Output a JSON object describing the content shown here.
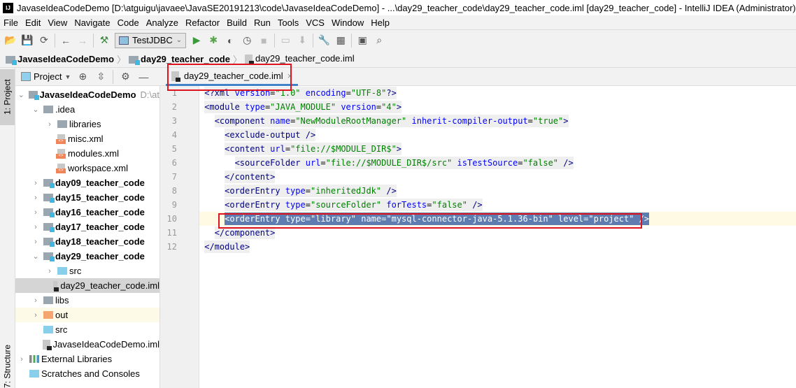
{
  "window": {
    "title": "JavaseIdeaCodeDemo [D:\\atguigu\\javaee\\JavaSE20191213\\code\\JavaseIdeaCodeDemo] - ...\\day29_teacher_code\\day29_teacher_code.iml [day29_teacher_code] - IntelliJ IDEA (Administrator)",
    "logo": "IJ"
  },
  "menu": [
    "File",
    "Edit",
    "View",
    "Navigate",
    "Code",
    "Analyze",
    "Refactor",
    "Build",
    "Run",
    "Tools",
    "VCS",
    "Window",
    "Help"
  ],
  "toolbar": {
    "run_config": "TestJDBC"
  },
  "breadcrumb": [
    "JavaseIdeaCodeDemo",
    "day29_teacher_code",
    "day29_teacher_code.iml"
  ],
  "stripe": {
    "project": "1: Project",
    "structure": "7: Structure"
  },
  "project_panel": {
    "title": "Project"
  },
  "tree": [
    {
      "label": "JavaseIdeaCodeDemo",
      "suffix": "D:\\at",
      "depth": 0,
      "arrow": "v",
      "icon": "module-folder",
      "bold": true
    },
    {
      "label": ".idea",
      "depth": 1,
      "arrow": "v",
      "icon": "folder"
    },
    {
      "label": "libraries",
      "depth": 2,
      "arrow": ">",
      "icon": "folder"
    },
    {
      "label": "misc.xml",
      "depth": 2,
      "arrow": "",
      "icon": "xml-file"
    },
    {
      "label": "modules.xml",
      "depth": 2,
      "arrow": "",
      "icon": "xml-file"
    },
    {
      "label": "workspace.xml",
      "depth": 2,
      "arrow": "",
      "icon": "xml-file"
    },
    {
      "label": "day09_teacher_code",
      "depth": 1,
      "arrow": ">",
      "icon": "module-folder",
      "bold": true
    },
    {
      "label": "day15_teacher_code",
      "depth": 1,
      "arrow": ">",
      "icon": "module-folder",
      "bold": true
    },
    {
      "label": "day16_teacher_code",
      "depth": 1,
      "arrow": ">",
      "icon": "module-folder",
      "bold": true
    },
    {
      "label": "day17_teacher_code",
      "depth": 1,
      "arrow": ">",
      "icon": "module-folder",
      "bold": true
    },
    {
      "label": "day18_teacher_code",
      "depth": 1,
      "arrow": ">",
      "icon": "module-folder",
      "bold": true
    },
    {
      "label": "day29_teacher_code",
      "depth": 1,
      "arrow": "v",
      "icon": "module-folder",
      "bold": true
    },
    {
      "label": "src",
      "depth": 2,
      "arrow": ">",
      "icon": "source-folder"
    },
    {
      "label": "day29_teacher_code.iml",
      "depth": 2,
      "arrow": "",
      "icon": "iml-file",
      "selected": true
    },
    {
      "label": "libs",
      "depth": 1,
      "arrow": ">",
      "icon": "folder"
    },
    {
      "label": "out",
      "depth": 1,
      "arrow": ">",
      "icon": "excluded-folder",
      "highlight": true
    },
    {
      "label": "src",
      "depth": 1,
      "arrow": "",
      "icon": "source-folder"
    },
    {
      "label": "JavaseIdeaCodeDemo.iml",
      "depth": 1,
      "arrow": "",
      "icon": "iml-file"
    },
    {
      "label": "External Libraries",
      "depth": 0,
      "arrow": ">",
      "icon": "libraries"
    },
    {
      "label": "Scratches and Consoles",
      "depth": 0,
      "arrow": "",
      "icon": "scratches"
    }
  ],
  "editor": {
    "tab": "day29_teacher_code.iml",
    "current_line": 10,
    "lines": [
      {
        "indent": "",
        "tokens": [
          [
            "t",
            "<?xml "
          ],
          [
            "a",
            "version"
          ],
          [
            "",
            "="
          ],
          [
            "v",
            "\"1.0\""
          ],
          [
            "",
            " "
          ],
          [
            "a",
            "encoding"
          ],
          [
            "",
            "="
          ],
          [
            "v",
            "\"UTF-8\""
          ],
          [
            "t",
            "?>"
          ]
        ]
      },
      {
        "indent": "",
        "tokens": [
          [
            "t",
            "<module "
          ],
          [
            "a",
            "type"
          ],
          [
            "",
            "="
          ],
          [
            "v",
            "\"JAVA_MODULE\""
          ],
          [
            "",
            " "
          ],
          [
            "a",
            "version"
          ],
          [
            "",
            "="
          ],
          [
            "v",
            "\"4\""
          ],
          [
            "t",
            ">"
          ]
        ]
      },
      {
        "indent": "  ",
        "tokens": [
          [
            "t",
            "<component "
          ],
          [
            "a",
            "name"
          ],
          [
            "",
            "="
          ],
          [
            "v",
            "\"NewModuleRootManager\""
          ],
          [
            "",
            " "
          ],
          [
            "a",
            "inherit-compiler-output"
          ],
          [
            "",
            "="
          ],
          [
            "v",
            "\"true\""
          ],
          [
            "t",
            ">"
          ]
        ]
      },
      {
        "indent": "    ",
        "tokens": [
          [
            "t",
            "<exclude-output />"
          ]
        ]
      },
      {
        "indent": "    ",
        "tokens": [
          [
            "t",
            "<content "
          ],
          [
            "a",
            "url"
          ],
          [
            "",
            "="
          ],
          [
            "v",
            "\"file://$MODULE_DIR$\""
          ],
          [
            "t",
            ">"
          ]
        ]
      },
      {
        "indent": "      ",
        "tokens": [
          [
            "t",
            "<sourceFolder "
          ],
          [
            "a",
            "url"
          ],
          [
            "",
            "="
          ],
          [
            "v",
            "\"file://$MODULE_DIR$/src\""
          ],
          [
            "",
            " "
          ],
          [
            "a",
            "isTestSource"
          ],
          [
            "",
            "="
          ],
          [
            "v",
            "\"false\""
          ],
          [
            "t",
            " />"
          ]
        ]
      },
      {
        "indent": "    ",
        "tokens": [
          [
            "t",
            "</content>"
          ]
        ]
      },
      {
        "indent": "    ",
        "tokens": [
          [
            "t",
            "<orderEntry "
          ],
          [
            "a",
            "type"
          ],
          [
            "",
            "="
          ],
          [
            "v",
            "\"inheritedJdk\""
          ],
          [
            "t",
            " />"
          ]
        ]
      },
      {
        "indent": "    ",
        "tokens": [
          [
            "t",
            "<orderEntry "
          ],
          [
            "a",
            "type"
          ],
          [
            "",
            "="
          ],
          [
            "v",
            "\"sourceFolder\""
          ],
          [
            "",
            " "
          ],
          [
            "a",
            "forTests"
          ],
          [
            "",
            "="
          ],
          [
            "v",
            "\"false\""
          ],
          [
            "t",
            " />"
          ]
        ]
      },
      {
        "indent": "    ",
        "tokens": [
          [
            "t",
            "<orderEntry "
          ],
          [
            "a",
            "type"
          ],
          [
            "",
            "="
          ],
          [
            "v",
            "\"library\""
          ],
          [
            "",
            " "
          ],
          [
            "a",
            "name"
          ],
          [
            "",
            "="
          ],
          [
            "v",
            "\"mysql-connector-java-5.1.36-bin\""
          ],
          [
            "",
            " "
          ],
          [
            "a",
            "level"
          ],
          [
            "",
            "="
          ],
          [
            "v",
            "\"project\""
          ],
          [
            "t",
            " />"
          ]
        ]
      },
      {
        "indent": "  ",
        "tokens": [
          [
            "t",
            "</component>"
          ]
        ]
      },
      {
        "indent": "",
        "tokens": [
          [
            "t",
            "</module>"
          ]
        ]
      }
    ]
  },
  "colors": {
    "tag": "#000080",
    "attribute": "#0000ff",
    "value": "#008000",
    "selection": "#5f7cb0",
    "annotation_box": "#e0141e"
  }
}
